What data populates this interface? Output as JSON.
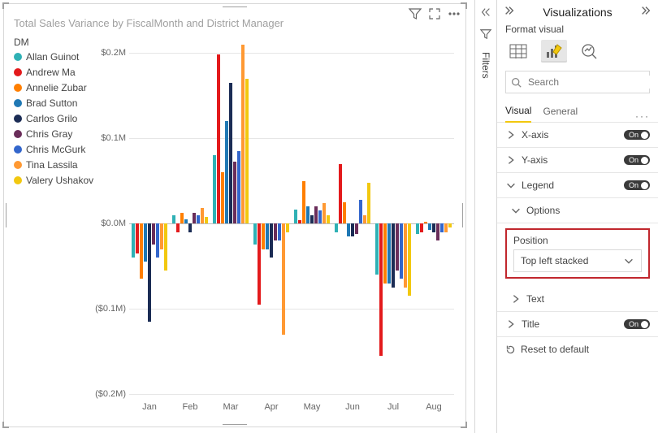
{
  "chart_data": {
    "type": "bar",
    "title": "Total Sales Variance by FiscalMonth and District Manager",
    "ylabel": "",
    "xlabel": "",
    "ylim": [
      -0.2,
      0.2
    ],
    "y_ticks": [
      {
        "v": 0.2,
        "label": "$0.2M"
      },
      {
        "v": 0.1,
        "label": "$0.1M"
      },
      {
        "v": 0.0,
        "label": "$0.0M"
      },
      {
        "v": -0.1,
        "label": "($0.1M)"
      },
      {
        "v": -0.2,
        "label": "($0.2M)"
      }
    ],
    "legend_title": "DM",
    "series": [
      {
        "name": "Allan Guinot",
        "color": "#2fb1b5"
      },
      {
        "name": "Andrew Ma",
        "color": "#e31a1c"
      },
      {
        "name": "Annelie Zubar",
        "color": "#ff7f00"
      },
      {
        "name": "Brad Sutton",
        "color": "#1f78b4"
      },
      {
        "name": "Carlos Grilo",
        "color": "#1b2c55"
      },
      {
        "name": "Chris Gray",
        "color": "#6a2d5a"
      },
      {
        "name": "Chris McGurk",
        "color": "#3366cc"
      },
      {
        "name": "Tina Lassila",
        "color": "#ff9933"
      },
      {
        "name": "Valery Ushakov",
        "color": "#f2c80f"
      }
    ],
    "categories": [
      "Jan",
      "Feb",
      "Mar",
      "Apr",
      "May",
      "Jun",
      "Jul",
      "Aug"
    ],
    "values": [
      [
        -0.04,
        -0.035,
        -0.065,
        -0.045,
        -0.115,
        -0.025,
        -0.04,
        -0.03,
        -0.055
      ],
      [
        0.01,
        -0.01,
        0.012,
        0.005,
        -0.01,
        0.012,
        0.01,
        0.018,
        0.008
      ],
      [
        0.08,
        0.198,
        0.06,
        0.12,
        0.165,
        0.072,
        0.085,
        0.21,
        0.17
      ],
      [
        -0.025,
        -0.095,
        -0.03,
        -0.03,
        -0.04,
        -0.02,
        -0.02,
        -0.13,
        -0.01
      ],
      [
        0.016,
        0.004,
        0.05,
        0.02,
        0.01,
        0.02,
        0.015,
        0.024,
        0.01
      ],
      [
        -0.01,
        0.07,
        0.025,
        -0.015,
        -0.015,
        -0.012,
        0.028,
        0.01,
        0.048
      ],
      [
        -0.06,
        -0.155,
        -0.07,
        -0.07,
        -0.075,
        -0.055,
        -0.065,
        -0.075,
        -0.085
      ],
      [
        -0.012,
        -0.01,
        0.002,
        -0.008,
        -0.01,
        -0.02,
        -0.01,
        -0.01,
        -0.005
      ]
    ]
  },
  "filters_rail": {
    "label": "Filters"
  },
  "viz_pane": {
    "title": "Visualizations",
    "subheader": "Format visual",
    "search_placeholder": "Search",
    "tabs": {
      "visual": "Visual",
      "general": "General"
    },
    "sections": {
      "x_axis": {
        "label": "X-axis",
        "toggle": "On"
      },
      "y_axis": {
        "label": "Y-axis",
        "toggle": "On"
      },
      "legend": {
        "label": "Legend",
        "toggle": "On"
      },
      "legend_options": {
        "label": "Options"
      },
      "legend_position": {
        "label": "Position",
        "value": "Top left stacked"
      },
      "legend_text": {
        "label": "Text"
      },
      "title": {
        "label": "Title",
        "toggle": "On"
      }
    },
    "reset": "Reset to default"
  }
}
